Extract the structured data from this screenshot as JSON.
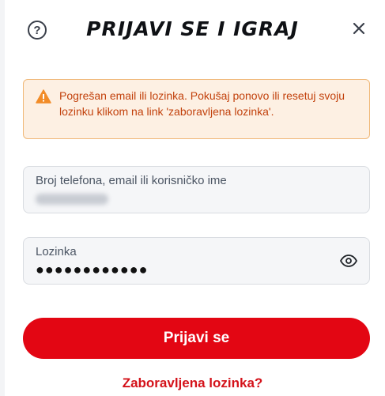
{
  "header": {
    "title": "PRIJAVI SE I IGRAJ",
    "help_symbol": "?",
    "help_icon": "question-circle-icon",
    "close_icon": "close-x-icon"
  },
  "alert": {
    "icon": "warning-triangle-icon",
    "message": "Pogrešan email ili lozinka. Pokušaj ponovo ili resetuj svoju lozinku klikom na link 'zaboravljena lozinka'."
  },
  "form": {
    "username_label": "Broj telefona, email ili korisničko ime",
    "password_label": "Lozinka",
    "password_value": "●●●●●●●●●●●●",
    "eye_icon": "eye-show-password-icon",
    "submit_label": "Prijavi se",
    "forgot_label": "Zaboravljena lozinka?"
  },
  "colors": {
    "accent": "#e30613",
    "alert_bg": "#fdf0e3",
    "alert_border": "#f0b878",
    "alert_text": "#c2410c",
    "warning_icon": "#f28c28"
  }
}
